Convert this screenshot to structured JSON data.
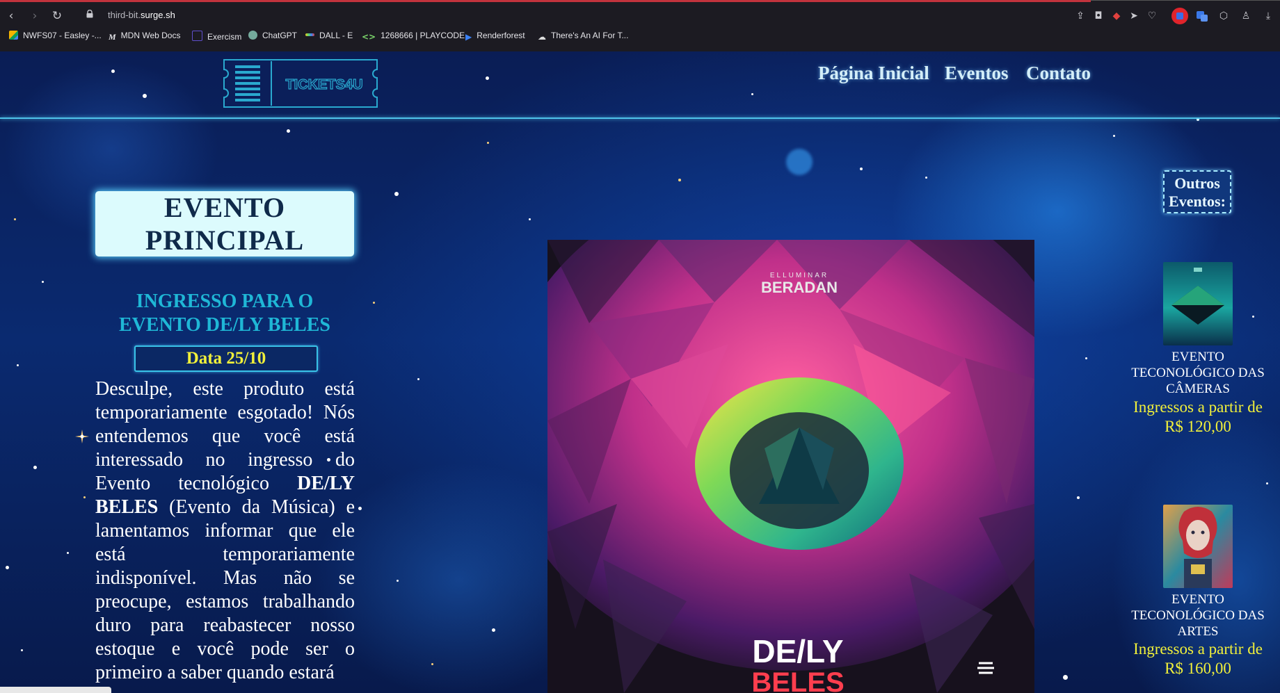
{
  "browser": {
    "url_prefix": "third-bit.",
    "url_domain": "surge.sh",
    "nav_icons": [
      "back-icon",
      "forward-icon",
      "reload-icon"
    ],
    "bookmarks": [
      {
        "label": "NWFS07 - Easley -...",
        "icon": "drive-icon",
        "color": "#f4b400"
      },
      {
        "label": "MDN Web Docs",
        "icon": "mdn-icon",
        "color": "#e6e6ea"
      },
      {
        "label": "Exercism",
        "icon": "exercism-icon",
        "color": "#604fcd"
      },
      {
        "label": "ChatGPT",
        "icon": "chatgpt-icon",
        "color": "#74aa9c"
      },
      {
        "label": "DALL - E",
        "icon": "dalle-icon",
        "color": "#f0c419"
      },
      {
        "label": "1268666 | PLAYCODE",
        "icon": "playcode-icon",
        "color": "#7bd66b"
      },
      {
        "label": "Renderforest",
        "icon": "renderforest-icon",
        "color": "#3b82f6"
      },
      {
        "label": "There's An AI For T...",
        "icon": "ai-icon",
        "color": "#dddddd"
      }
    ]
  },
  "site": {
    "logo_text": "TICKETS4U",
    "nav": [
      "Página Inicial",
      "Eventos",
      "Contato"
    ]
  },
  "main": {
    "section_title_line1": "EVENTO",
    "section_title_line2": "PRINCIPAL",
    "ticket_title": "INGRESSO PARA O EVENTO DE/LY BELES",
    "date": "Data 25/10",
    "body_part1": "Desculpe, este produto está temporariamente esgotado! Nós entendemos que você está interessado no ingresso do Evento tecnológico ",
    "body_bold": "DE/LY BELES",
    "body_part2": " (Evento da Música) e lamentamos informar que ele está temporariamente indisponível. Mas não se preocupe, estamos trabalhando duro para reabastecer nosso estoque e você pode ser o primeiro a saber quando estará",
    "poster": {
      "top_text": "BERADAN",
      "small_text": "ELLUMINAR",
      "title_line1": "DE/LY",
      "title_line2": "BELES"
    }
  },
  "sidebar": {
    "title": "Outros Eventos:",
    "events": [
      {
        "name": "EVENTO TECONOLÓGICO DAS CÂMERAS",
        "price": "Ingressos a partir de R$ 120,00"
      },
      {
        "name": "EVENTO TECONOLÓGICO DAS ARTES",
        "price": "Ingressos a partir de R$ 160,00"
      }
    ]
  }
}
